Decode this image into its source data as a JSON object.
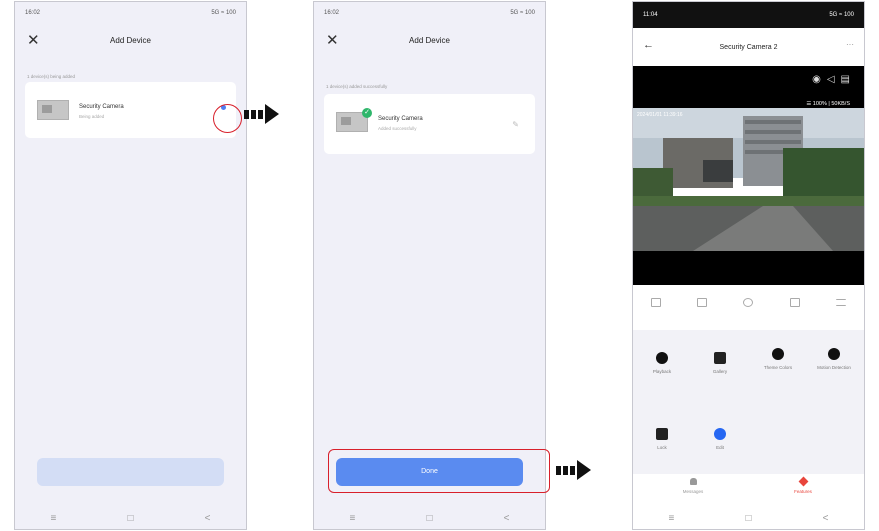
{
  "phone1": {
    "status_time": "16:02",
    "status_right": "5G ≈ 100",
    "title": "Add Device",
    "section_label": "1 device(s) being added",
    "device_name": "Security Camera",
    "device_status": "Being added",
    "close_icon": "✕"
  },
  "phone2": {
    "status_time": "16:02",
    "status_right": "5G ≈ 100",
    "title": "Add Device",
    "section_label": "1 device(s) added successfully",
    "device_name": "Security Camera",
    "device_status": "Added successfully",
    "done_label": "Done",
    "close_icon": "✕"
  },
  "phone3": {
    "status_time": "11:04",
    "status_right": "5G ≈ 100",
    "title": "Security Camera 2",
    "timestamp": "2024/01/01 11:39:16",
    "network": "☰ 100% | 50KB/S",
    "more_icon": "···",
    "back_icon": "←",
    "features": [
      {
        "label": "Playback",
        "icon": "play-icon"
      },
      {
        "label": "Gallery",
        "icon": "gallery-icon"
      },
      {
        "label": "Theme Colors",
        "icon": "palette-icon"
      },
      {
        "label": "Motion Detection",
        "icon": "motion-icon"
      },
      {
        "label": "Lock",
        "icon": "lock-icon"
      },
      {
        "label": "Edit",
        "icon": "edit-icon"
      }
    ],
    "tabs": [
      "Messages",
      "Features"
    ]
  },
  "navbar": {
    "menu": "≡",
    "home": "□",
    "back": "<"
  },
  "colors": {
    "accent": "#5a8bf0",
    "highlight": "#d8202b",
    "success": "#2fb66b"
  }
}
